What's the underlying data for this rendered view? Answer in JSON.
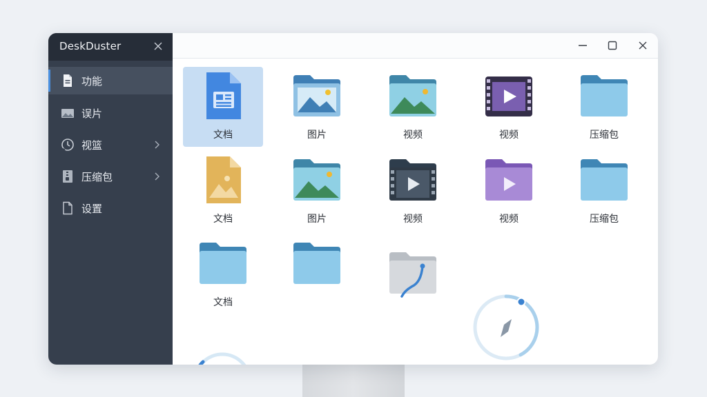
{
  "app": {
    "title": "DeskDuster"
  },
  "sidebar": {
    "items": [
      {
        "label": "功能",
        "icon": "document-icon",
        "active": true,
        "has_submenu": false
      },
      {
        "label": "误片",
        "icon": "image-icon",
        "active": false,
        "has_submenu": false
      },
      {
        "label": "视篮",
        "icon": "clock-icon",
        "active": false,
        "has_submenu": true
      },
      {
        "label": "压缩包",
        "icon": "archive-icon",
        "active": false,
        "has_submenu": true
      },
      {
        "label": "设置",
        "icon": "blank-file-icon",
        "active": false,
        "has_submenu": false
      }
    ]
  },
  "grid": {
    "rows": [
      [
        {
          "label": "文档",
          "icon": "document-file-icon",
          "selected": true
        },
        {
          "label": "图片",
          "icon": "image-folder-icon"
        },
        {
          "label": "视频",
          "icon": "image-folder-icon"
        },
        {
          "label": "视频",
          "icon": "video-icon"
        },
        {
          "label": "压缩包",
          "icon": "folder-icon"
        }
      ],
      [
        {
          "label": "文档",
          "icon": "image-file-icon"
        },
        {
          "label": "图片",
          "icon": "image-folder-icon"
        },
        {
          "label": "视频",
          "icon": "video-folder-icon"
        },
        {
          "label": "视频",
          "icon": "purple-video-folder-icon"
        },
        {
          "label": "压缩包",
          "icon": "folder-icon"
        }
      ],
      [
        {
          "label": "文档",
          "icon": "folder-icon"
        },
        {
          "label": "",
          "icon": "folder-icon"
        },
        {
          "label": "",
          "icon": "grey-folder-cable-icon"
        }
      ]
    ]
  },
  "colors": {
    "accent": "#4a8fdf",
    "sidebar_bg": "#363f4d",
    "selected_tile": "#c7ddf3"
  }
}
